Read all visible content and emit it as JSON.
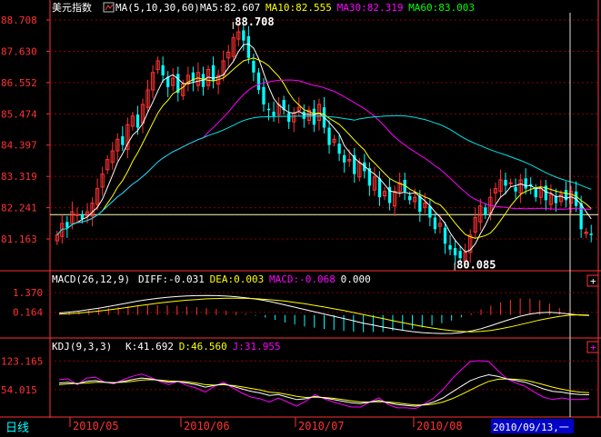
{
  "chart_data": [
    {
      "type": "candlestick",
      "title": "美元指数",
      "indicator": "MA(5,10,30,60)",
      "ma_labels": [
        {
          "name": "MA5",
          "value": "82.607",
          "color": "#ffffff"
        },
        {
          "name": "MA10",
          "value": "82.555",
          "color": "#ffff00"
        },
        {
          "name": "MA30",
          "value": "82.319",
          "color": "#ff00ff"
        },
        {
          "name": "MA60",
          "value": "83.003",
          "color": "#00ff00"
        }
      ],
      "y_ticks": [
        "88.708",
        "87.630",
        "86.552",
        "85.474",
        "84.397",
        "83.319",
        "82.241",
        "81.163"
      ],
      "y_tick_values": [
        88.708,
        87.63,
        86.552,
        85.474,
        84.397,
        83.319,
        82.241,
        81.163
      ],
      "ylim": [
        80.1,
        88.708
      ],
      "high_label": "88.708",
      "low_label": "80.085",
      "high_value": 88.708,
      "low_value": 80.085,
      "horizontal_line": 82.0,
      "colors": {
        "up": "#ff3232",
        "down": "#00ffff",
        "ma5": "#ffffff",
        "ma10": "#ffff00",
        "ma30": "#ff00ff",
        "ma60": "#00e5e5"
      },
      "closes": [
        81.3,
        81.7,
        81.55,
        82.1,
        82.0,
        81.85,
        82.1,
        82.4,
        82.9,
        83.4,
        83.9,
        84.2,
        84.6,
        84.4,
        85.1,
        85.4,
        85.0,
        85.8,
        86.3,
        86.9,
        87.3,
        86.8,
        86.4,
        86.7,
        86.2,
        86.5,
        86.8,
        86.6,
        86.9,
        86.4,
        87.0,
        86.6,
        86.8,
        87.3,
        87.6,
        88.1,
        88.3,
        88.0,
        87.4,
        86.9,
        86.3,
        85.8,
        85.6,
        85.4,
        85.8,
        85.6,
        85.2,
        85.5,
        85.7,
        85.3,
        85.6,
        85.1,
        85.8,
        85.0,
        84.4,
        84.6,
        84.1,
        83.8,
        83.9,
        83.4,
        83.8,
        83.5,
        83.0,
        83.3,
        82.6,
        82.8,
        82.4,
        82.8,
        83.1,
        82.8,
        82.5,
        82.6,
        82.1,
        82.4,
        81.9,
        81.5,
        81.7,
        81.0,
        80.8,
        80.6,
        80.5,
        80.7,
        81.3,
        81.9,
        82.3,
        82.0,
        82.6,
        82.9,
        83.2,
        83.0,
        83.1,
        82.8,
        83.2,
        82.9,
        83.0,
        82.6,
        82.9,
        82.5,
        82.7,
        82.4,
        82.7,
        82.5,
        82.8,
        82.3,
        81.5,
        81.4,
        81.3
      ],
      "dates": [
        "2010/05",
        "2010/06",
        "2010/07",
        "2010/08"
      ],
      "cursor_date": "2010/09/13,一"
    },
    {
      "type": "bar",
      "title": "MACD",
      "indicator": "MACD(26,12,9)",
      "labels": [
        {
          "name": "DIFF",
          "value": "-0.031",
          "color": "#ffffff"
        },
        {
          "name": "DEA",
          "value": "0.003",
          "color": "#ffff00"
        },
        {
          "name": "MACD",
          "value": "-0.068",
          "color": "#ff00ff"
        },
        {
          "name": "",
          "value": "0.000",
          "color": "#ffffff"
        }
      ],
      "y_ticks": [
        "1.370",
        "0.164"
      ],
      "y_tick_values": [
        1.37,
        0.164
      ],
      "ylim": [
        -1.3,
        1.6
      ],
      "diff": [
        0.12,
        0.18,
        0.24,
        0.33,
        0.42,
        0.52,
        0.63,
        0.74,
        0.85,
        0.94,
        1.02,
        1.08,
        1.13,
        1.17,
        1.19,
        1.2,
        1.19,
        1.16,
        1.12,
        1.06,
        0.98,
        0.88,
        0.76,
        0.62,
        0.48,
        0.34,
        0.2,
        0.06,
        -0.08,
        -0.22,
        -0.36,
        -0.5,
        -0.62,
        -0.74,
        -0.84,
        -0.94,
        -1.02,
        -1.08,
        -1.12,
        -1.14,
        -1.13,
        -1.08,
        -0.98,
        -0.84,
        -0.66,
        -0.46,
        -0.26,
        -0.08,
        0.06,
        0.14,
        0.16,
        0.12,
        0.06,
        0.0,
        -0.03
      ],
      "dea": [
        0.05,
        0.08,
        0.12,
        0.18,
        0.24,
        0.31,
        0.39,
        0.47,
        0.56,
        0.64,
        0.72,
        0.79,
        0.85,
        0.91,
        0.95,
        0.99,
        1.01,
        1.03,
        1.03,
        1.02,
        1.0,
        0.96,
        0.91,
        0.85,
        0.77,
        0.69,
        0.59,
        0.49,
        0.38,
        0.27,
        0.15,
        0.03,
        -0.1,
        -0.22,
        -0.35,
        -0.47,
        -0.59,
        -0.7,
        -0.8,
        -0.89,
        -0.96,
        -1.01,
        -1.03,
        -1.01,
        -0.95,
        -0.85,
        -0.73,
        -0.59,
        -0.45,
        -0.31,
        -0.19,
        -0.09,
        -0.02,
        0.01,
        0.0
      ],
      "macd": [
        0.14,
        0.2,
        0.24,
        0.3,
        0.36,
        0.42,
        0.48,
        0.54,
        0.58,
        0.6,
        0.6,
        0.58,
        0.56,
        0.52,
        0.48,
        0.42,
        0.36,
        0.26,
        0.18,
        0.08,
        -0.04,
        -0.16,
        -0.3,
        -0.46,
        -0.58,
        -0.7,
        -0.78,
        -0.86,
        -0.92,
        -0.98,
        -1.02,
        -1.06,
        -1.04,
        -1.04,
        -0.98,
        -0.94,
        -0.86,
        -0.76,
        -0.64,
        -0.5,
        -0.34,
        -0.14,
        0.1,
        0.34,
        0.58,
        0.78,
        0.94,
        1.02,
        1.02,
        0.9,
        0.7,
        0.42,
        0.16,
        -0.02,
        -0.06
      ]
    },
    {
      "type": "line",
      "title": "KDJ",
      "indicator": "KDJ(9,3,3)",
      "labels": [
        {
          "name": "K",
          "value": "41.692",
          "color": "#ffffff"
        },
        {
          "name": "D",
          "value": "46.560",
          "color": "#ffff00"
        },
        {
          "name": "J",
          "value": "31.955",
          "color": "#ff00ff"
        }
      ],
      "y_ticks": [
        "123.165",
        "54.015"
      ],
      "y_tick_values": [
        123.165,
        54.015
      ],
      "ylim": [
        -10,
        135
      ],
      "k": [
        70,
        72,
        68,
        74,
        76,
        72,
        70,
        74,
        78,
        82,
        80,
        76,
        72,
        74,
        70,
        66,
        60,
        64,
        68,
        62,
        56,
        50,
        46,
        40,
        42,
        36,
        30,
        32,
        38,
        34,
        30,
        26,
        22,
        20,
        24,
        28,
        22,
        18,
        16,
        14,
        18,
        24,
        34,
        48,
        62,
        76,
        84,
        90,
        86,
        80,
        76,
        72,
        64,
        56,
        50,
        48,
        44,
        42,
        41.7
      ],
      "d": [
        66,
        68,
        69,
        70,
        72,
        72,
        71,
        72,
        74,
        77,
        78,
        77,
        75,
        74,
        73,
        70,
        66,
        65,
        66,
        64,
        61,
        57,
        53,
        48,
        46,
        42,
        38,
        35,
        36,
        35,
        33,
        30,
        27,
        24,
        24,
        25,
        24,
        22,
        19,
        17,
        17,
        19,
        24,
        32,
        42,
        53,
        64,
        74,
        79,
        80,
        79,
        77,
        72,
        66,
        60,
        55,
        51,
        48,
        46.6
      ],
      "j": [
        78,
        80,
        66,
        82,
        84,
        72,
        68,
        78,
        86,
        92,
        84,
        74,
        66,
        74,
        64,
        58,
        48,
        62,
        72,
        58,
        46,
        36,
        32,
        24,
        34,
        24,
        14,
        26,
        42,
        32,
        24,
        18,
        12,
        12,
        24,
        34,
        18,
        10,
        10,
        8,
        20,
        34,
        54,
        80,
        102,
        122,
        124,
        122,
        100,
        80,
        70,
        62,
        48,
        36,
        30,
        34,
        30,
        30,
        32
      ]
    }
  ],
  "footer": {
    "period_label": "日线"
  }
}
